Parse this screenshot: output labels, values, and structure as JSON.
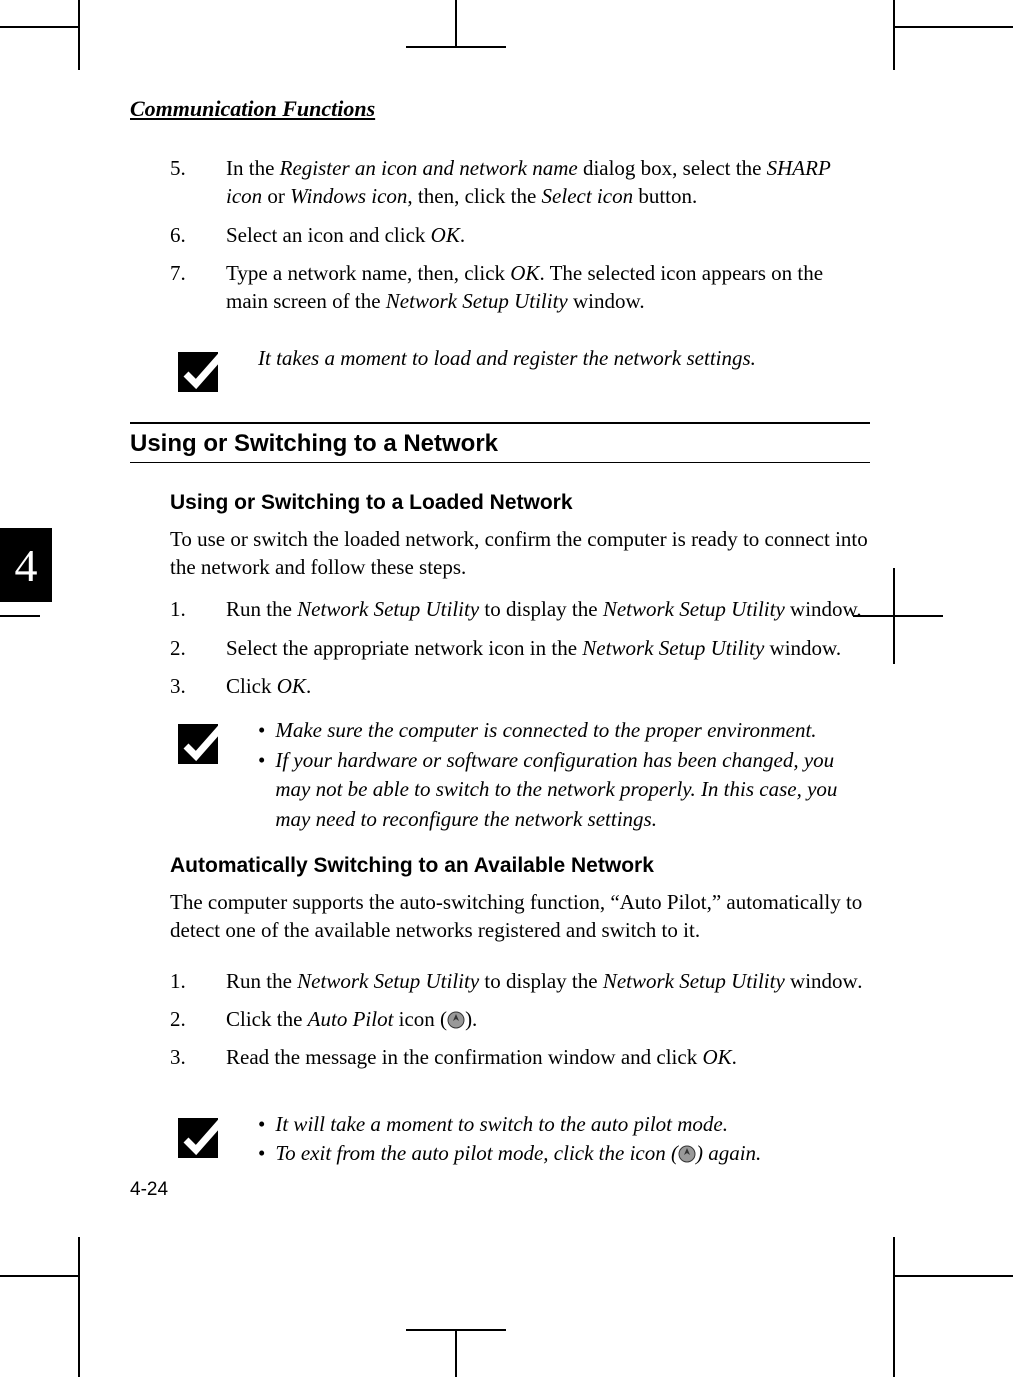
{
  "header": {
    "title": "Communication Functions"
  },
  "chapter": {
    "tab": "4"
  },
  "steps_a": [
    {
      "num": "5.",
      "pre": "In the ",
      "i1": "Register an icon and network name",
      "mid1": " dialog box, select the ",
      "i2": "SHARP icon",
      "mid2": " or ",
      "i3": "Windows icon",
      "mid3": ", then, click the ",
      "i4": "Select icon",
      "post": " button."
    },
    {
      "num": "6.",
      "pre": "Select an icon and click ",
      "i1": "OK",
      "post": "."
    },
    {
      "num": "7.",
      "pre": "Type a network name, then, click ",
      "i1": "OK",
      "mid1": ". The selected icon appears on the main screen of the ",
      "i2": "Network Setup Utility",
      "post": " window."
    }
  ],
  "note1": {
    "text": "It takes a moment to load and register the network settings."
  },
  "section1": {
    "title": "Using or Switching to a Network",
    "sub1": {
      "title": "Using or Switching to a Loaded Network",
      "intro": "To use or switch the loaded network, confirm the computer is ready to connect into the network and follow these steps.",
      "steps": [
        {
          "num": "1.",
          "pre": "Run the ",
          "i1": "Network Setup Utility",
          "mid1": " to display the ",
          "i2": "Network Setup Utility",
          "post": " window."
        },
        {
          "num": "2.",
          "pre": "Select the appropriate network icon in the ",
          "i1": "Network Setup Utility",
          "post": " window."
        },
        {
          "num": "3.",
          "pre": "Click ",
          "i1": "OK",
          "post": "."
        }
      ],
      "note": {
        "b1": "Make sure the computer is connected to the proper environment.",
        "b2": "If your hardware or software configuration has been changed, you may not be able to switch to the network properly. In this case, you may need to reconfigure the network settings."
      }
    },
    "sub2": {
      "title": "Automatically Switching to an Available Network",
      "intro": "The computer supports the auto-switching function, “Auto Pilot,” automatically to detect one of the available networks registered and switch to it.",
      "steps": [
        {
          "num": "1.",
          "pre": "Run the ",
          "i1": "Network Setup Utility",
          "mid1": " to display the ",
          "i2": "Network Setup Utility",
          "post": " window",
          "postItalic": "."
        },
        {
          "num": "2.",
          "pre": "Click the ",
          "i1": "Auto Pilot",
          "mid1": " icon (",
          "icon": true,
          "post": ")."
        },
        {
          "num": "3.",
          "pre": "Read the message in the confirmation window and click ",
          "i1": "OK",
          "post": "."
        }
      ],
      "note": {
        "b1": "It will take a moment to switch to the auto pilot mode.",
        "b2a": "To exit from the auto pilot mode, click the icon (",
        "b2b": ") again."
      }
    }
  },
  "pagenum": "4-24"
}
